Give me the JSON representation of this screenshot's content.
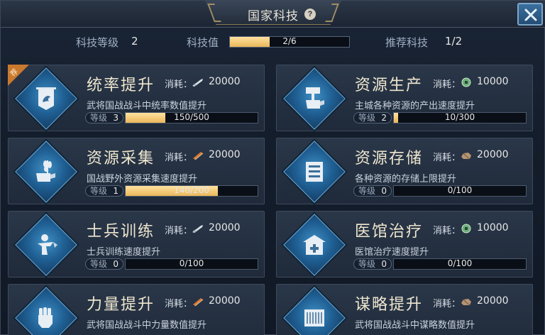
{
  "window": {
    "title": "国家科技"
  },
  "stats": {
    "level_label": "科技等级",
    "level_value": "2",
    "points_label": "科技值",
    "points_text": "2/6",
    "points_fraction": 0.333,
    "recommend_label": "推荐科技",
    "recommend_value": "1/2"
  },
  "cost_label": "消耗：",
  "recommend_badge": "荐",
  "techs": [
    {
      "name": "统率提升",
      "cost_icon": "sword-icon",
      "cost": "20000",
      "desc": "武将国战战斗中统率数值提升",
      "level_label": "等级",
      "level": "3",
      "progress_text": "150/500",
      "progress_fraction": 0.3,
      "icon": "banner-icon",
      "recommended": true
    },
    {
      "name": "资源生产",
      "cost_icon": "coin-icon",
      "cost": "10000",
      "desc": "主城各种资源的产出速度提升",
      "level_label": "等级",
      "level": "2",
      "progress_text": "10/300",
      "progress_fraction": 0.033,
      "icon": "hammer-hand-icon"
    },
    {
      "name": "资源采集",
      "cost_icon": "wood-icon",
      "cost": "20000",
      "desc": "国战野外资源采集速度提升",
      "level_label": "等级",
      "level": "1",
      "progress_text": "140/200",
      "progress_fraction": 0.7,
      "icon": "wheat-hand-icon"
    },
    {
      "name": "资源存储",
      "cost_icon": "stone-icon",
      "cost": "20000",
      "desc": "各种资源的存储上限提升",
      "level_label": "等级",
      "level": "0",
      "progress_text": "0/100",
      "progress_fraction": 0,
      "icon": "storage-box-icon"
    },
    {
      "name": "士兵训练",
      "cost_icon": "sword-icon",
      "cost": "20000",
      "desc": "士兵训练速度提升",
      "level_label": "等级",
      "level": "0",
      "progress_text": "0/100",
      "progress_fraction": 0,
      "icon": "soldier-icon"
    },
    {
      "name": "医馆治疗",
      "cost_icon": "coin-icon",
      "cost": "10000",
      "desc": "医馆治疗速度提升",
      "level_label": "等级",
      "level": "0",
      "progress_text": "0/100",
      "progress_fraction": 0,
      "icon": "hospital-icon"
    },
    {
      "name": "力量提升",
      "cost_icon": "wood-icon",
      "cost": "20000",
      "desc": "武将国战战斗中力量数值提升",
      "icon": "fist-icon"
    },
    {
      "name": "谋略提升",
      "cost_icon": "stone-icon",
      "cost": "20000",
      "desc": "武将国战战斗中谋略数值提升",
      "icon": "scroll-icon"
    }
  ]
}
